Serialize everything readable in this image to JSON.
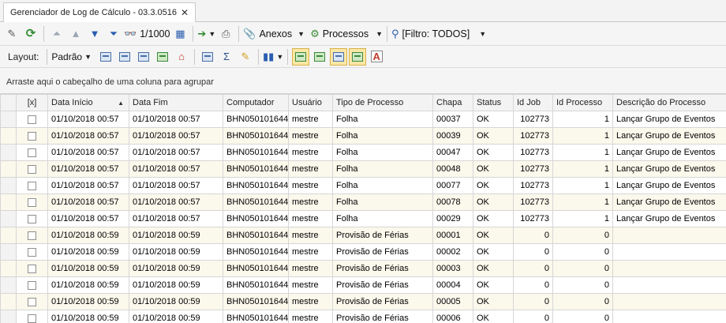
{
  "tab": {
    "title": "Gerenciador de Log de Cálculo - 03.3.0516",
    "close": "✕"
  },
  "toolbar": {
    "page_counter": "1/1000",
    "anexos_label": "Anexos",
    "processos_label": "Processos",
    "filtro_label": "[Filtro: TODOS]"
  },
  "layout_bar": {
    "layout_label": "Layout:",
    "padrao_label": "Padrão"
  },
  "group_panel": {
    "hint": "Arraste aqui o cabeçalho de uma coluna para agrupar"
  },
  "grid": {
    "columns": [
      "[x]",
      "Data Início",
      "Data Fim",
      "Computador",
      "Usuário",
      "Tipo de Processo",
      "Chapa",
      "Status",
      "Id Job",
      "Id Processo",
      "Descrição do Processo"
    ],
    "sort_indicator": "▲",
    "rows": [
      [
        "01/10/2018 00:57",
        "01/10/2018 00:57",
        "BHN050101644",
        "mestre",
        "Folha",
        "00037",
        "OK",
        "102773",
        "1",
        "Lançar Grupo de Eventos"
      ],
      [
        "01/10/2018 00:57",
        "01/10/2018 00:57",
        "BHN050101644",
        "mestre",
        "Folha",
        "00039",
        "OK",
        "102773",
        "1",
        "Lançar Grupo de Eventos"
      ],
      [
        "01/10/2018 00:57",
        "01/10/2018 00:57",
        "BHN050101644",
        "mestre",
        "Folha",
        "00047",
        "OK",
        "102773",
        "1",
        "Lançar Grupo de Eventos"
      ],
      [
        "01/10/2018 00:57",
        "01/10/2018 00:57",
        "BHN050101644",
        "mestre",
        "Folha",
        "00048",
        "OK",
        "102773",
        "1",
        "Lançar Grupo de Eventos"
      ],
      [
        "01/10/2018 00:57",
        "01/10/2018 00:57",
        "BHN050101644",
        "mestre",
        "Folha",
        "00077",
        "OK",
        "102773",
        "1",
        "Lançar Grupo de Eventos"
      ],
      [
        "01/10/2018 00:57",
        "01/10/2018 00:57",
        "BHN050101644",
        "mestre",
        "Folha",
        "00078",
        "OK",
        "102773",
        "1",
        "Lançar Grupo de Eventos"
      ],
      [
        "01/10/2018 00:57",
        "01/10/2018 00:57",
        "BHN050101644",
        "mestre",
        "Folha",
        "00029",
        "OK",
        "102773",
        "1",
        "Lançar Grupo de Eventos"
      ],
      [
        "01/10/2018 00:59",
        "01/10/2018 00:59",
        "BHN050101644",
        "mestre",
        "Provisão de Férias",
        "00001",
        "OK",
        "0",
        "0",
        ""
      ],
      [
        "01/10/2018 00:59",
        "01/10/2018 00:59",
        "BHN050101644",
        "mestre",
        "Provisão de Férias",
        "00002",
        "OK",
        "0",
        "0",
        ""
      ],
      [
        "01/10/2018 00:59",
        "01/10/2018 00:59",
        "BHN050101644",
        "mestre",
        "Provisão de Férias",
        "00003",
        "OK",
        "0",
        "0",
        ""
      ],
      [
        "01/10/2018 00:59",
        "01/10/2018 00:59",
        "BHN050101644",
        "mestre",
        "Provisão de Férias",
        "00004",
        "OK",
        "0",
        "0",
        ""
      ],
      [
        "01/10/2018 00:59",
        "01/10/2018 00:59",
        "BHN050101644",
        "mestre",
        "Provisão de Férias",
        "00005",
        "OK",
        "0",
        "0",
        ""
      ],
      [
        "01/10/2018 00:59",
        "01/10/2018 00:59",
        "BHN050101644",
        "mestre",
        "Provisão de Férias",
        "00006",
        "OK",
        "0",
        "0",
        ""
      ]
    ]
  }
}
